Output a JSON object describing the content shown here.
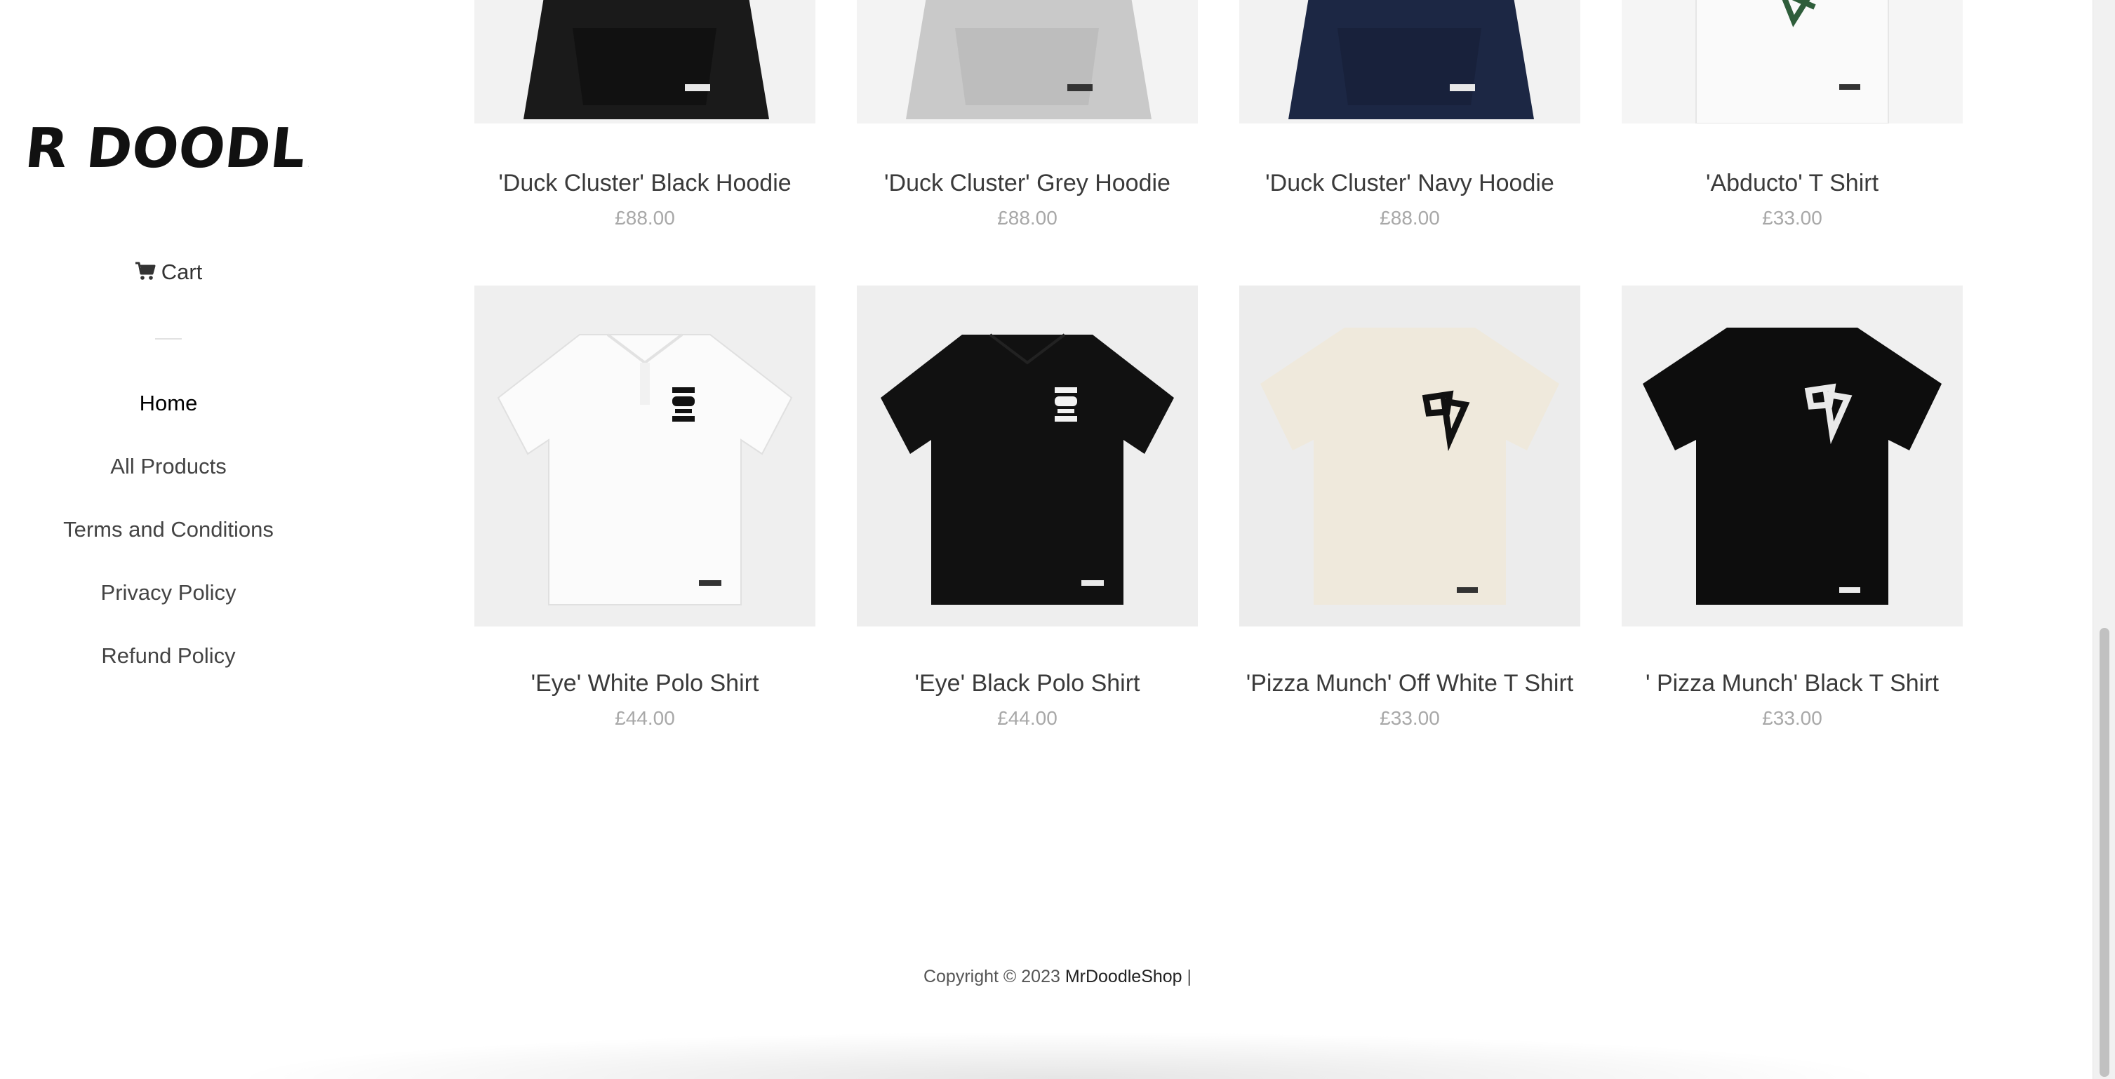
{
  "brand": {
    "logo_text": "MR DOODLE!"
  },
  "sidebar": {
    "cart_label": "Cart",
    "nav": [
      {
        "label": "Home",
        "active": true
      },
      {
        "label": "All Products"
      },
      {
        "label": "Terms and Conditions"
      },
      {
        "label": "Privacy Policy"
      },
      {
        "label": "Refund Policy"
      }
    ]
  },
  "products": [
    {
      "title": "'Duck Cluster' Black Hoodie",
      "price": "£88.00",
      "icon": "black-hoodie",
      "color": "#1a1a1a"
    },
    {
      "title": "'Duck Cluster' Grey Hoodie",
      "price": "£88.00",
      "icon": "grey-hoodie",
      "color": "#c9c9c9"
    },
    {
      "title": "'Duck Cluster' Navy Hoodie",
      "price": "£88.00",
      "icon": "navy-hoodie",
      "color": "#1c2744"
    },
    {
      "title": "'Abducto' T Shirt",
      "price": "£33.00",
      "icon": "white-tshirt",
      "color": "#fafafa"
    },
    {
      "title": "'Eye' White Polo Shirt",
      "price": "£44.00",
      "icon": "white-polo",
      "color": "#fbfbfb"
    },
    {
      "title": "'Eye' Black Polo Shirt",
      "price": "£44.00",
      "icon": "black-polo",
      "color": "#111111"
    },
    {
      "title": "'Pizza Munch' Off White T Shirt",
      "price": "£33.00",
      "icon": "offwhite-tshirt",
      "color": "#efe9dc"
    },
    {
      "title": "' Pizza Munch' Black T Shirt",
      "price": "£33.00",
      "icon": "black-tshirt",
      "color": "#0d0d0d"
    }
  ],
  "footer": {
    "copyright": "Copyright © 2023",
    "shop": "MrDoodleShop",
    "separator": "|"
  }
}
